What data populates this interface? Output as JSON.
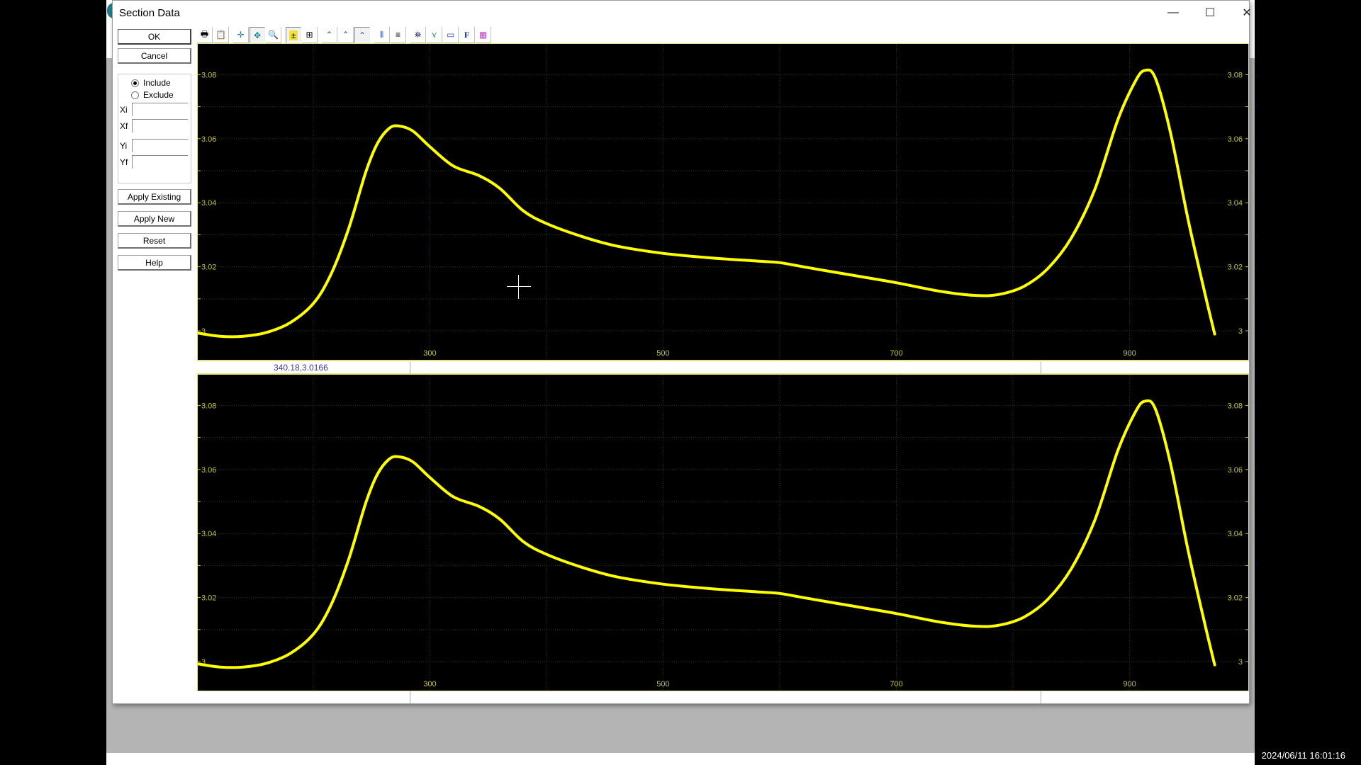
{
  "desktop": {
    "clock": "2024/06/11 16:01:16"
  },
  "dialog": {
    "title": "Section Data",
    "window_buttons": {
      "minimize": "—",
      "maximize": "☐",
      "close": "✕"
    }
  },
  "left_panel": {
    "ok_label": "OK",
    "cancel_label": "Cancel",
    "include_label": "Include",
    "exclude_label": "Exclude",
    "selected_mode": "Include",
    "fields": [
      {
        "label": "Xi",
        "value": ""
      },
      {
        "label": "Xf",
        "value": ""
      },
      {
        "label": "Yi",
        "value": ""
      },
      {
        "label": "Yf",
        "value": ""
      }
    ],
    "apply_existing_label": "Apply Existing",
    "apply_new_label": "Apply New",
    "reset_label": "Reset",
    "help_label": "Help"
  },
  "toolbar": {
    "buttons": [
      {
        "name": "print",
        "glyph": "🖶"
      },
      {
        "name": "clipboard",
        "glyph": "📋"
      },
      {
        "name": "crosshair-cursor",
        "glyph": "✛"
      },
      {
        "name": "pan-cursor",
        "glyph": "✥",
        "pressed": true
      },
      {
        "name": "zoom",
        "glyph": "🔍"
      },
      {
        "name": "marker-add",
        "glyph": "±",
        "pressed": true
      },
      {
        "name": "marker-box",
        "glyph": "⊞"
      },
      {
        "name": "peak-1",
        "glyph": "⌃"
      },
      {
        "name": "peak-2",
        "glyph": "⌃"
      },
      {
        "name": "peak-3",
        "glyph": "⌃",
        "pressed": true
      },
      {
        "name": "vertical-grid",
        "glyph": "⦀"
      },
      {
        "name": "horizontal-grid",
        "glyph": "≡"
      },
      {
        "name": "find",
        "glyph": "⛯"
      },
      {
        "name": "tree",
        "glyph": "⋎"
      },
      {
        "name": "display",
        "glyph": "▭"
      },
      {
        "name": "font",
        "glyph": "F"
      },
      {
        "name": "colors",
        "glyph": "▦"
      }
    ]
  },
  "status": {
    "cursor_readout": "340.18,3.0166"
  },
  "colors": {
    "plot_bg": "#000000",
    "trace": "#ffff00",
    "axis_text": "#c8c23a",
    "grid": "#1f3b3b",
    "border": "#e6e27a"
  },
  "chart_data": [
    {
      "type": "line",
      "title": "",
      "xlabel": "",
      "ylabel": "",
      "xlim": [
        101,
        1003
      ],
      "ylim": [
        2.9905,
        3.0896
      ],
      "x_ticks": [
        300,
        500,
        700,
        900
      ],
      "x_tick_labels": [
        "300",
        "500",
        "700",
        "900"
      ],
      "x_grid": [
        200,
        300,
        400,
        500,
        600,
        700,
        800,
        900
      ],
      "y_ticks": [
        3.0,
        3.02,
        3.04,
        3.06,
        3.08
      ],
      "y_tick_labels": [
        "3",
        "3.02",
        "3.04",
        "3.06",
        "3.08"
      ],
      "y_grid": [
        3.0,
        3.01,
        3.02,
        3.03,
        3.04,
        3.05,
        3.06,
        3.07,
        3.08
      ],
      "grid": true,
      "series": [
        {
          "name": "section",
          "x": [
            101,
            120,
            140,
            160,
            180,
            200,
            215,
            230,
            245,
            255,
            265,
            273,
            285,
            300,
            320,
            342,
            360,
            380,
            400,
            430,
            460,
            500,
            540,
            580,
            600,
            620,
            660,
            700,
            740,
            770,
            790,
            810,
            830,
            850,
            870,
            890,
            905,
            913,
            922,
            935,
            950,
            965,
            973
          ],
          "y": [
            2.9993,
            2.9983,
            2.9983,
            2.9995,
            3.0025,
            3.0085,
            3.0175,
            3.0315,
            3.0495,
            3.0585,
            3.0632,
            3.064,
            3.0625,
            3.0575,
            3.0515,
            3.0485,
            3.0445,
            3.0375,
            3.0335,
            3.0295,
            3.0265,
            3.0242,
            3.0228,
            3.0218,
            3.0213,
            3.02,
            3.0175,
            3.015,
            3.0122,
            3.011,
            3.0115,
            3.014,
            3.0195,
            3.029,
            3.044,
            3.066,
            3.078,
            3.0813,
            3.079,
            3.062,
            3.035,
            3.011,
            2.999
          ]
        }
      ],
      "crosshair": {
        "x": 340.18,
        "y": 3.0166
      }
    },
    {
      "type": "line",
      "title": "",
      "xlabel": "",
      "ylabel": "",
      "xlim": [
        101,
        1003
      ],
      "ylim": [
        2.9905,
        3.0896
      ],
      "x_ticks": [
        300,
        500,
        700,
        900
      ],
      "x_tick_labels": [
        "300",
        "500",
        "700",
        "900"
      ],
      "x_grid": [
        200,
        300,
        400,
        500,
        600,
        700,
        800,
        900
      ],
      "y_ticks": [
        3.0,
        3.02,
        3.04,
        3.06,
        3.08
      ],
      "y_tick_labels": [
        "3",
        "3.02",
        "3.04",
        "3.06",
        "3.08"
      ],
      "y_grid": [
        3.0,
        3.01,
        3.02,
        3.03,
        3.04,
        3.05,
        3.06,
        3.07,
        3.08
      ],
      "grid": true,
      "series": [
        {
          "name": "section",
          "x": [
            101,
            120,
            140,
            160,
            180,
            200,
            215,
            230,
            245,
            255,
            265,
            273,
            285,
            300,
            320,
            342,
            360,
            380,
            400,
            430,
            460,
            500,
            540,
            580,
            600,
            620,
            660,
            700,
            740,
            770,
            790,
            810,
            830,
            850,
            870,
            890,
            905,
            913,
            922,
            935,
            950,
            965,
            973
          ],
          "y": [
            2.9993,
            2.9983,
            2.9983,
            2.9995,
            3.0025,
            3.0085,
            3.0175,
            3.0315,
            3.0495,
            3.0585,
            3.0632,
            3.064,
            3.0625,
            3.0575,
            3.0515,
            3.0485,
            3.0445,
            3.0375,
            3.0335,
            3.0295,
            3.0265,
            3.0242,
            3.0228,
            3.0218,
            3.0213,
            3.02,
            3.0175,
            3.015,
            3.0122,
            3.011,
            3.0115,
            3.014,
            3.0195,
            3.029,
            3.044,
            3.066,
            3.078,
            3.0813,
            3.079,
            3.062,
            3.035,
            3.011,
            2.999
          ]
        }
      ]
    }
  ]
}
